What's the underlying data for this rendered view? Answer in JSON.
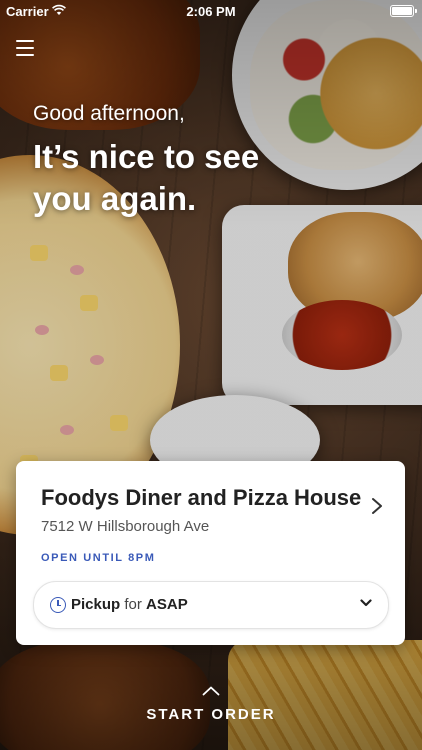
{
  "status_bar": {
    "carrier": "Carrier",
    "time": "2:06 PM"
  },
  "header": {
    "menu_icon": "hamburger-menu-icon"
  },
  "greeting": "Good afternoon,",
  "headline": "It’s nice to see you again.",
  "restaurant": {
    "name": "Foodys Diner and Pizza House",
    "address": "7512 W Hillsborough Ave",
    "status": "OPEN UNTIL 8PM"
  },
  "order_mode": {
    "mode": "Pickup",
    "connector": "for",
    "time": "ASAP"
  },
  "cta": {
    "label": "START ORDER"
  },
  "colors": {
    "accent": "#3a5ab8",
    "card_bg": "#ffffff",
    "text": "#222222"
  }
}
